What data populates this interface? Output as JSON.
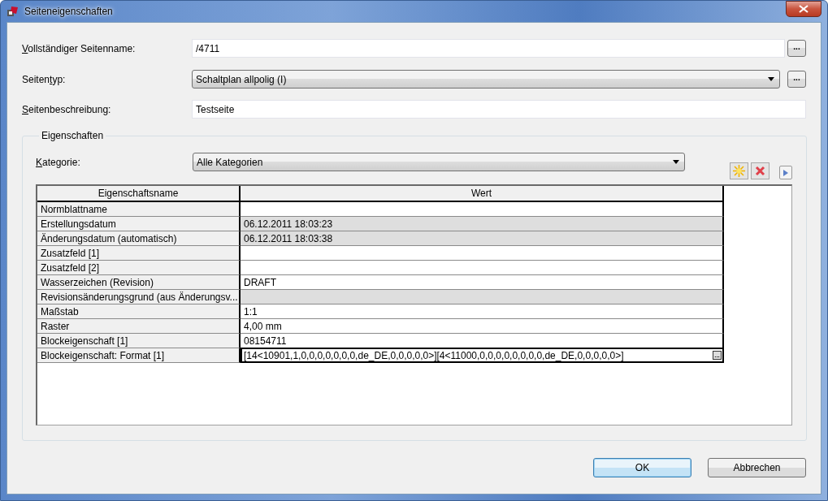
{
  "window": {
    "title": "Seiteneigenschaften"
  },
  "fields": [
    {
      "kind": "text",
      "label": {
        "key": "V",
        "after": "ollständiger Seitenname:"
      },
      "value": "/4711",
      "browse": "..."
    },
    {
      "kind": "dropdown",
      "label": {
        "before": "Seiten",
        "key": "t",
        "after": "yp:"
      },
      "value": "Schaltplan allpolig (I)",
      "browse": "..."
    },
    {
      "kind": "text",
      "label": {
        "key": "S",
        "after": "eitenbeschreibung:"
      },
      "value": "Testseite"
    }
  ],
  "group": {
    "title": "Eigenschaften",
    "category": {
      "label": {
        "key": "K",
        "after": "ategorie:"
      },
      "value": "Alle Kategorien"
    },
    "table": {
      "columns": [
        "Eigenschaftsname",
        "Wert"
      ],
      "rows": [
        {
          "name": "Normblattname",
          "readonly": false,
          "selected": false
        },
        {
          "name": "Erstellungsdatum",
          "value": "06.12.2011 18:03:23",
          "readonly": true,
          "selected": false
        },
        {
          "name": "Änderungsdatum (automatisch)",
          "value": "06.12.2011 18:03:38",
          "readonly": true,
          "selected": false
        },
        {
          "name": "Zusatzfeld [1]",
          "readonly": false,
          "selected": false
        },
        {
          "name": "Zusatzfeld [2]",
          "readonly": false,
          "selected": false
        },
        {
          "name": "Wasserzeichen (Revision)",
          "value": "DRAFT",
          "readonly": false,
          "selected": false
        },
        {
          "name": "Revisionsänderungsgrund (aus Änderungsv...",
          "readonly": true,
          "selected": false
        },
        {
          "name": "Maßstab",
          "value": "1:1",
          "readonly": false,
          "selected": false
        },
        {
          "name": "Raster",
          "value": "4,00 mm",
          "readonly": false,
          "selected": false
        },
        {
          "name": "Blockeigenschaft [1]",
          "value": "08154711",
          "readonly": false,
          "selected": false
        },
        {
          "name": "Blockeigenschaft: Format [1]",
          "value": "[14<10901,1,0,0,0,0,0,0,0,de_DE,0,0,0,0,0>][4<11000,0,0,0,0,0,0,0,0,de_DE,0,0,0,0,0>]",
          "readonly": false,
          "selected": true
        }
      ]
    }
  },
  "buttons": [
    {
      "label": "OK",
      "default": true
    },
    {
      "label": "Abbrechen",
      "default": false
    }
  ]
}
